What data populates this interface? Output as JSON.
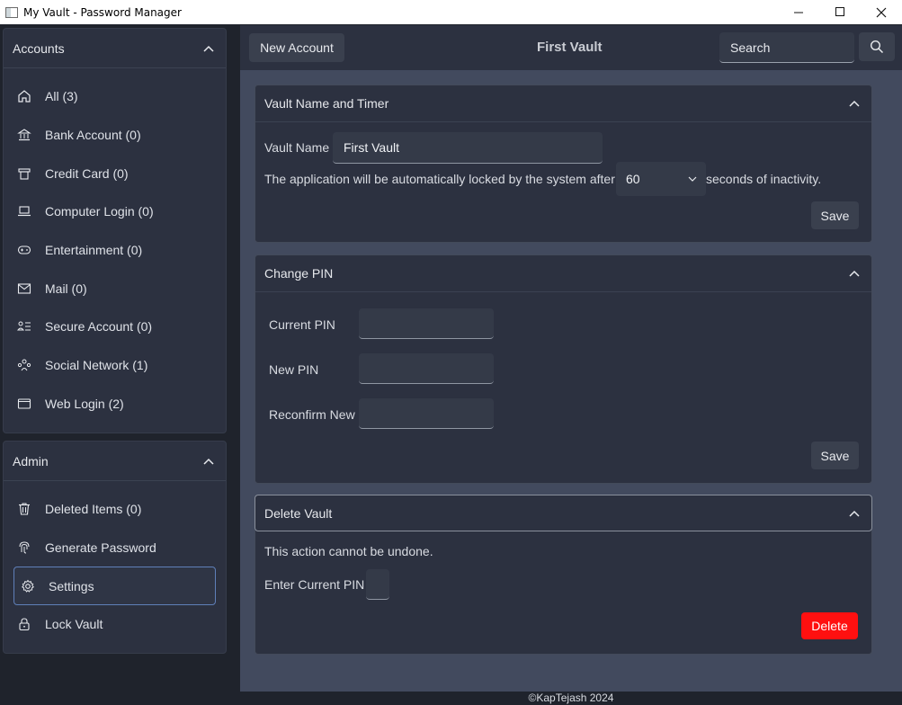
{
  "window": {
    "title": "My Vault - Password Manager",
    "controls": [
      "minimize",
      "maximize",
      "close"
    ]
  },
  "sidebar": {
    "accounts": {
      "title": "Accounts",
      "items": [
        {
          "label": "All (3)",
          "icon": "home-icon"
        },
        {
          "label": "Bank Account (0)",
          "icon": "bank-icon"
        },
        {
          "label": "Credit Card (0)",
          "icon": "credit-card-icon"
        },
        {
          "label": "Computer Login (0)",
          "icon": "laptop-icon"
        },
        {
          "label": "Entertainment (0)",
          "icon": "gamepad-icon"
        },
        {
          "label": "Mail (0)",
          "icon": "mail-icon"
        },
        {
          "label": "Secure Account (0)",
          "icon": "list-user-icon"
        },
        {
          "label": "Social Network (1)",
          "icon": "people-icon"
        },
        {
          "label": "Web Login (2)",
          "icon": "window-icon"
        }
      ]
    },
    "admin": {
      "title": "Admin",
      "items": [
        {
          "label": "Deleted Items (0)",
          "icon": "trash-icon"
        },
        {
          "label": "Generate Password",
          "icon": "fingerprint-icon"
        },
        {
          "label": "Settings",
          "icon": "gear-icon",
          "active": true
        },
        {
          "label": "Lock Vault",
          "icon": "lock-icon"
        }
      ]
    }
  },
  "topbar": {
    "new_account_label": "New Account",
    "vault_title": "First Vault",
    "search_placeholder": "Search"
  },
  "vault_card": {
    "title": "Vault Name and Timer",
    "name_label": "Vault Name",
    "name_value": "First Vault",
    "timer_text_before": "The application will be automatically locked by the system after",
    "timer_value": "60",
    "timer_text_after": "seconds of inactivity.",
    "save_label": "Save"
  },
  "pin_card": {
    "title": "Change PIN",
    "current_label": "Current PIN",
    "new_label": "New PIN",
    "reconfirm_label": "Reconfirm New PIN",
    "save_label": "Save"
  },
  "delete_card": {
    "title": "Delete Vault",
    "warning": "This action cannot be undone.",
    "pin_label": "Enter Current PIN",
    "delete_label": "Delete",
    "delete_color": "#ff1010"
  },
  "footer": {
    "text": "©KapTejash 2024"
  },
  "colors": {
    "background": "#1f232c",
    "panel": "#2c3140",
    "content": "#424a5e",
    "active_border": "#5f7fb8"
  }
}
